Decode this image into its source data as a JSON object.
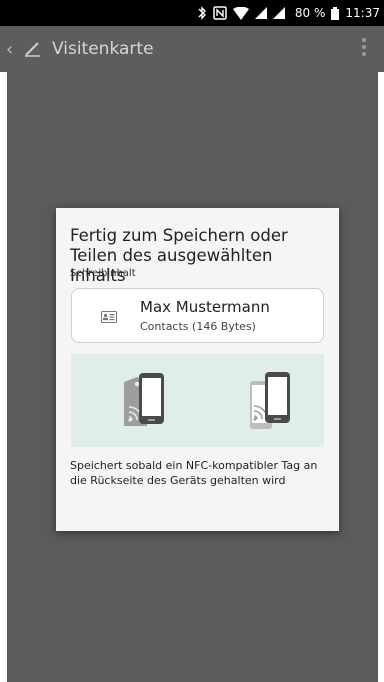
{
  "status_bar": {
    "battery_label": "80 %",
    "time": "11:37",
    "icons": [
      "bluetooth-icon",
      "nfc-icon",
      "wifi-icon",
      "signal-icon",
      "signal-icon",
      "battery-icon"
    ]
  },
  "app_bar": {
    "title": "Visitenkarte",
    "icons": [
      "back-icon",
      "pencil-icon",
      "overflow-menu-icon"
    ]
  },
  "dialog": {
    "title": "Fertig zum Speichern oder Teilen des ausgewählten Inhalts",
    "subtitle": "Schreibinhalt",
    "content": {
      "icon": "contact-card-icon",
      "name": "Max Mustermann",
      "detail": "Contacts (146 Bytes)"
    },
    "illustrations": [
      "nfc-tag-phone-icon",
      "phone-to-phone-icon"
    ],
    "description": "Speichert sobald ein NFC-kompatibler Tag an die Rückseite des Geräts gehalten wird"
  },
  "colors": {
    "status_bar": "#000000",
    "app_bar": "#5d5d5d",
    "scrim": "#5b5b5b",
    "dialog": "#f5f5f5",
    "nfc_panel": "#e0eeeb"
  }
}
